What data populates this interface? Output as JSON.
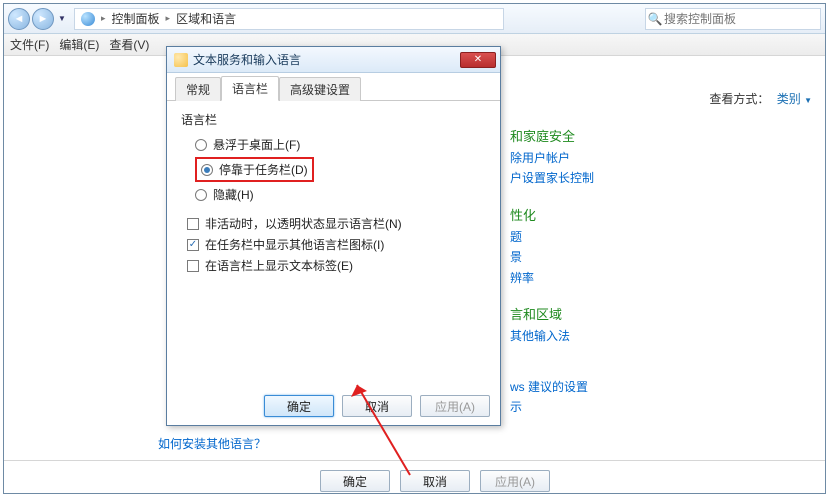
{
  "window": {
    "title": "区域和语言",
    "win_min": "—",
    "win_max": "❐",
    "win_close": "✕"
  },
  "breadcrumb": {
    "root": "控制面板",
    "sep": "▸",
    "current": "区域和语言"
  },
  "search": {
    "placeholder": "搜索控制面板"
  },
  "menubar": {
    "file": "文件(F)",
    "edit": "编辑(E)",
    "view": "查看(V)"
  },
  "viewmode": {
    "label": "查看方式：",
    "value": "类别"
  },
  "rightlinks": {
    "g1_hdr": "和家庭安全",
    "g1_l1": "除用户帐户",
    "g1_l2": "户设置家长控制",
    "g2_hdr": "性化",
    "g2_l1": "题",
    "g2_l2": "景",
    "g2_l3": "辨率",
    "g3_hdr": "言和区域",
    "g3_l1": "其他输入法",
    "g4_l1": "ws 建议的设置",
    "g4_l2": "示"
  },
  "dialog": {
    "title": "文本服务和输入语言",
    "tabs": {
      "t1": "常规",
      "t2": "语言栏",
      "t3": "高级键设置"
    },
    "group_title": "语言栏",
    "radio1": "悬浮于桌面上(F)",
    "radio2": "停靠于任务栏(D)",
    "radio3": "隐藏(H)",
    "check1": "非活动时，以透明状态显示语言栏(N)",
    "check2": "在任务栏中显示其他语言栏图标(I)",
    "check3": "在语言栏上显示文本标签(E)",
    "ok": "确定",
    "cancel": "取消",
    "apply": "应用(A)"
  },
  "bottom_link": "如何安装其他语言？",
  "parent_buttons": {
    "ok": "确定",
    "cancel": "取消",
    "apply": "应用(A)"
  }
}
